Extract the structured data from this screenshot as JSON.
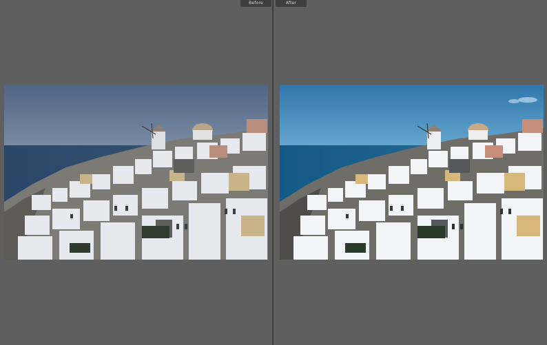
{
  "compare": {
    "before_label": "Before",
    "after_label": "After"
  },
  "colors": {
    "background": "#5f5f5f",
    "label_bg": "#3e3e3e",
    "before_sky": "#5a6f8c",
    "after_sky": "#3f86b8",
    "before_sea": "#2f4d6e",
    "after_sea": "#1d5f8c"
  }
}
